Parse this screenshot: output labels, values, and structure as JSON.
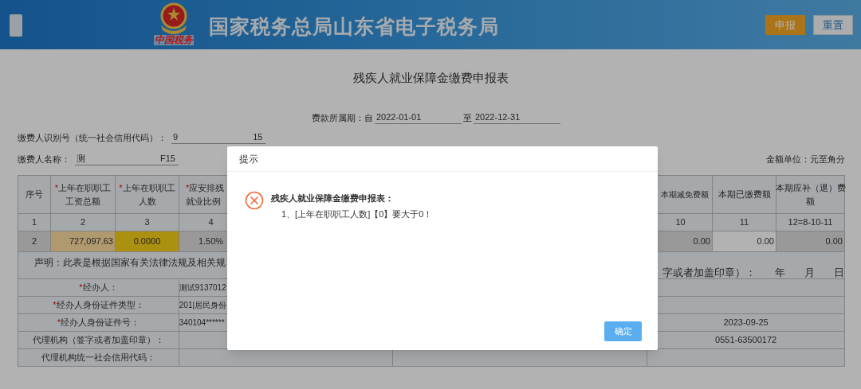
{
  "header": {
    "title": "国家税务总局山东省电子税务局",
    "logo_caption": "中国税务",
    "buttons": [
      {
        "label": "申报",
        "kind": "primary"
      },
      {
        "label": "重置",
        "kind": "secondary"
      }
    ]
  },
  "form": {
    "title": "残疾人就业保障金缴费申报表",
    "period": {
      "label": "费款所属期：自",
      "from": "2022-01-01",
      "to_label": "至",
      "to": "2022-12-31"
    },
    "payer_id": {
      "label": "缴费人识别号（统一社会信用代码）：",
      "value_start": "9",
      "value_end": "15"
    },
    "payer_name": {
      "label": "缴费人名称：",
      "value_start": "测",
      "value_end": "F15"
    },
    "unit_note": "金额单位：元至角分"
  },
  "table": {
    "columns": [
      {
        "lines": [
          "序号"
        ]
      },
      {
        "marker": "*",
        "lines": [
          "上年在职职工",
          "工资总额"
        ]
      },
      {
        "marker": "*",
        "lines": [
          "上年在职职工",
          "人数"
        ]
      },
      {
        "marker": "*",
        "lines": [
          "应安排残",
          "就业比例"
        ]
      },
      {
        "lines": [
          "本期减免费额"
        ]
      },
      {
        "lines": [
          "本期已缴费额"
        ]
      },
      {
        "lines": [
          "本期应补（退）费",
          "额"
        ]
      }
    ],
    "index_row": [
      "1",
      "2",
      "3",
      "4",
      "10",
      "11",
      "12=8-10-11"
    ],
    "data_row": [
      {
        "value": "2",
        "color": "#9a9a9a"
      },
      {
        "value": "727,097.63",
        "color": "#b09a70"
      },
      {
        "value": "0.0000",
        "color": "#ad9010"
      },
      {
        "value": "1.50%",
        "color": "#9a9a9a"
      },
      {
        "value": "0.00",
        "color": "#9a9a9a"
      },
      {
        "value": "0.00",
        "color": "#b3b3b3"
      },
      {
        "value": "0.00",
        "color": "#9a9a9a"
      }
    ]
  },
  "declaration": {
    "text": "声明：此表是根据国家有关法律法规及相关规",
    "signature_label": "字或者加盖印章）：",
    "date_parts": [
      "年",
      "月",
      "日"
    ]
  },
  "lower_rows": [
    {
      "marker": "*",
      "label": "经办人：",
      "value": "测试9137012",
      "right_value": ""
    },
    {
      "marker": "*",
      "label": "经办人身份证件类型：",
      "value": "201|居民身份",
      "right_value": ""
    },
    {
      "marker": "*",
      "label": "经办人身份证件号：",
      "value": "340104******",
      "right_value": "2023-09-25"
    },
    {
      "label": "代理机构（签字或者加盖印章）：",
      "value": "",
      "right_value": "0551-63500172"
    },
    {
      "label": "代理机构统一社会信用代码：",
      "value": "",
      "right_value": ""
    }
  ],
  "dialog": {
    "title": "提示",
    "heading": "残疾人就业保障金缴费申报表：",
    "message": "1、[上年在职职工人数]【0】要大于0！",
    "button": "确定"
  }
}
